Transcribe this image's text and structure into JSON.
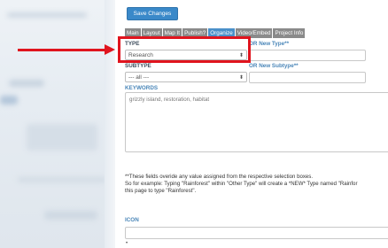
{
  "toolbar": {
    "save_label": "Save Changes"
  },
  "tabs": [
    {
      "label": "Main",
      "active": false
    },
    {
      "label": "Layout",
      "active": false
    },
    {
      "label": "Map It",
      "active": false
    },
    {
      "label": "Publish?",
      "active": false
    },
    {
      "label": "Organize",
      "active": true
    },
    {
      "label": "Video/Embed",
      "active": false
    },
    {
      "label": "Project Info",
      "active": false
    }
  ],
  "form": {
    "type_label": "TYPE",
    "type_value": "Research",
    "new_type_label": "OR New Type**",
    "subtype_label": "SUBTYPE",
    "subtype_value": "--- all ---",
    "new_subtype_label": "OR New Subtype**",
    "keywords_label": "KEYWORDS",
    "keywords_value": "grizzly island, restoration, habitat",
    "icon_label": "ICON"
  },
  "notes": {
    "line1": "**These fields overide any value assigned from the respective selection boxes.",
    "line2": "So for example: Typing \"Rainforest\" within \"Other Type\" will create a *NEW* Type named \"Rainfor",
    "line3": "this page to type \"Rainforest\"."
  },
  "icons": {
    "select_arrow": "updown-arrow-icon"
  },
  "colors": {
    "accent": "#3a89c9",
    "annotation_red": "#e0141e",
    "tab_gray": "#8a8a8a"
  }
}
